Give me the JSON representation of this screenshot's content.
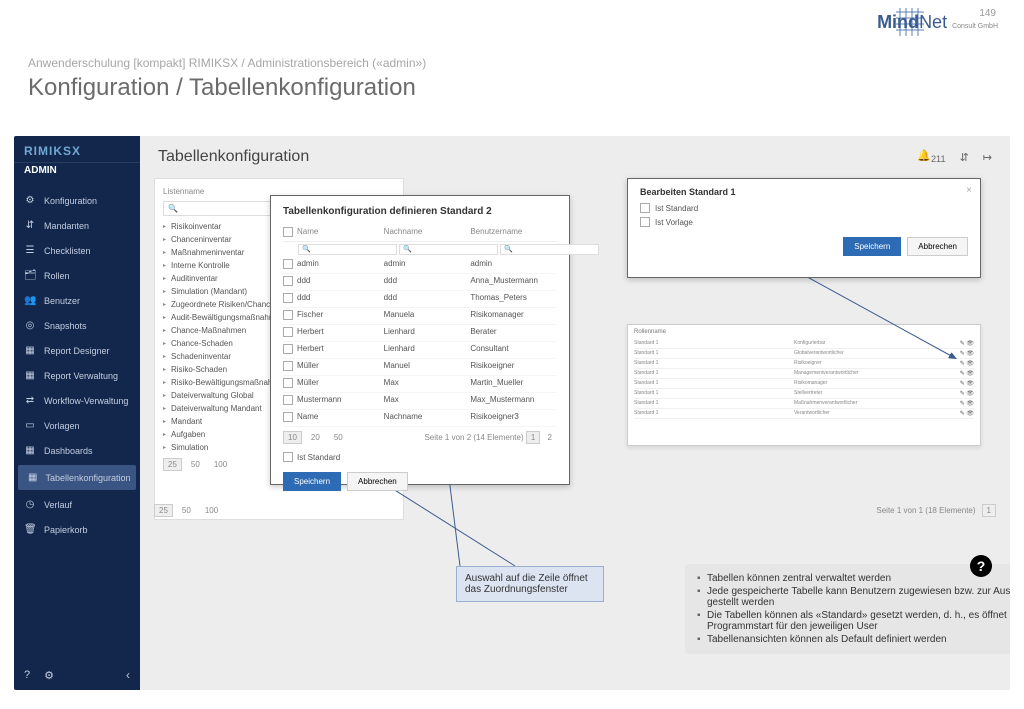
{
  "page_number": "149",
  "brand": {
    "name": "MindNet",
    "suffix": "Consult GmbH"
  },
  "breadcrumb": "Anwenderschulung [kompakt] RIMIKSX / Administrationsbereich («admin»)",
  "page_title": "Konfiguration / Tabellenkonfiguration",
  "sidebar": {
    "logo": "RIMIKSX",
    "section": "ADMIN",
    "items": [
      {
        "icon": "⚙",
        "label": "Konfiguration"
      },
      {
        "icon": "⇵",
        "label": "Mandanten"
      },
      {
        "icon": "☰",
        "label": "Checklisten"
      },
      {
        "icon": "🗂",
        "label": "Rollen"
      },
      {
        "icon": "👥",
        "label": "Benutzer"
      },
      {
        "icon": "◎",
        "label": "Snapshots"
      },
      {
        "icon": "▦",
        "label": "Report Designer"
      },
      {
        "icon": "▦",
        "label": "Report Verwaltung"
      },
      {
        "icon": "⇄",
        "label": "Workflow-Verwaltung"
      },
      {
        "icon": "▭",
        "label": "Vorlagen"
      },
      {
        "icon": "▦",
        "label": "Dashboards"
      },
      {
        "icon": "▦",
        "label": "Tabellenkonfiguration"
      },
      {
        "icon": "◷",
        "label": "Verlauf"
      },
      {
        "icon": "🗑",
        "label": "Papierkorb"
      }
    ],
    "footer_icons": [
      "?",
      "⚙"
    ],
    "collapse": "‹"
  },
  "main": {
    "title": "Tabellenkonfiguration",
    "header": {
      "bell": "🔔",
      "count": "211",
      "tree": "⇵",
      "logout": "↦"
    }
  },
  "lists_panel": {
    "header": "Listenname",
    "search_ph": "🔍",
    "rows": [
      "Risikoinventar",
      "Chanceninventar",
      "Maßnahmeninventar",
      "Interne Kontrolle",
      "Auditinventar",
      "Simulation (Mandant)",
      "Zugeordnete Risiken/Chance",
      "Audit-Bewältigungsmaßnahm",
      "Chance-Maßnahmen",
      "Chance-Schaden",
      "Schadeninventar",
      "Risiko-Schaden",
      "Risiko-Bewältigungsmaßnahm",
      "Dateiverwaltung Global",
      "Dateiverwaltung Mandant",
      "Mandant",
      "Aufgaben",
      "Simulation"
    ],
    "page_sizes": [
      "25",
      "50",
      "100"
    ],
    "sel_size": "25"
  },
  "config_dialog": {
    "title": "Tabellenkonfiguration definieren Standard 2",
    "columns": [
      "Name",
      "Nachname",
      "Benutzername"
    ],
    "rows": [
      [
        "admin",
        "admin",
        "admin"
      ],
      [
        "ddd",
        "ddd",
        "Anna_Mustermann"
      ],
      [
        "ddd",
        "ddd",
        "Thomas_Peters"
      ],
      [
        "Fischer",
        "Manuela",
        "Risikomanager"
      ],
      [
        "Herbert",
        "Lienhard",
        "Berater"
      ],
      [
        "Herbert",
        "Lienhard",
        "Consultant"
      ],
      [
        "Müller",
        "Manuel",
        "Risikoeigner"
      ],
      [
        "Müller",
        "Max",
        "Martin_Mueller"
      ],
      [
        "Mustermann",
        "Max",
        "Max_Mustermann"
      ],
      [
        "Name",
        "Nachname",
        "Risikoeigner3"
      ]
    ],
    "page_sizes": [
      "10",
      "20",
      "50"
    ],
    "sel_size": "10",
    "pager_info": "Seite 1 von 2 (14 Elemente)",
    "pages": [
      "1",
      "2"
    ],
    "checkbox": "Ist Standard",
    "save": "Speichern",
    "cancel": "Abbrechen"
  },
  "edit_dialog": {
    "title": "Bearbeiten Standard 1",
    "chk1": "Ist Standard",
    "chk2": "Ist Vorlage",
    "save": "Speichern",
    "cancel": "Abbrechen"
  },
  "preview_panel": {
    "header": "Rollenname",
    "rows": [
      [
        "Standard 1",
        "Konfigurierbar"
      ],
      [
        "Standard 1",
        "Globalverantwortlicher"
      ],
      [
        "Standard 1",
        "Risikoeigner"
      ],
      [
        "Standard 1",
        "Managementverantwortlicher"
      ],
      [
        "Standard 1",
        "Risikomanager"
      ],
      [
        "Standard 1",
        "Stellvertreter"
      ],
      [
        "Standard 1",
        "Maßnahmenverantwortlicher"
      ],
      [
        "Standard 1",
        "Verantwortlicher"
      ]
    ]
  },
  "bottom_pager": {
    "sizes": [
      "25",
      "50",
      "100"
    ],
    "sel": "25",
    "info": "Seite 1 von 1 (18 Elemente)",
    "page": "1"
  },
  "callout": "Auswahl auf die Zeile öffnet das Zuordnungsfenster",
  "info_bullets": [
    "Tabellen können zentral verwaltet werden",
    "Jede gespeicherte Tabelle kann Benutzern zugewiesen bzw. zur Auswahl bereit gestellt werden",
    "Die Tabellen können als «Standard» gesetzt werden, d. h., es öffnet sich beim Programmstart für den jeweiligen User",
    "Tabellenansichten können als Default definiert werden"
  ],
  "help": "?"
}
